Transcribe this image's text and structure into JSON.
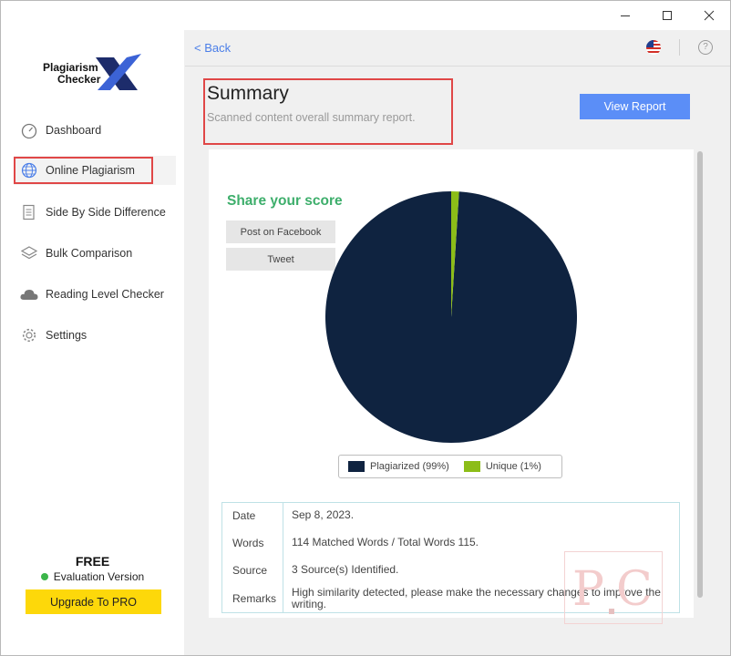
{
  "window": {
    "controls": [
      "minimize",
      "maximize",
      "close"
    ]
  },
  "sidebar": {
    "logo": {
      "line1": "Plagiarism",
      "line2": "Checker",
      "mark": "X"
    },
    "items": [
      {
        "label": "Dashboard",
        "icon": "gauge-icon"
      },
      {
        "label": "Online Plagiarism",
        "icon": "globe-icon",
        "active": true
      },
      {
        "label": "Side By Side Difference",
        "icon": "document-icon"
      },
      {
        "label": "Bulk Comparison",
        "icon": "layers-icon"
      },
      {
        "label": "Reading Level Checker",
        "icon": "cloud-icon"
      },
      {
        "label": "Settings",
        "icon": "gear-icon"
      }
    ],
    "plan": {
      "name": "FREE",
      "version": "Evaluation Version",
      "status_color": "#3bb54a"
    },
    "upgrade_label": "Upgrade To PRO"
  },
  "header": {
    "back_label": "< Back",
    "language_icon": "us-flag-icon",
    "help_icon": "help-icon"
  },
  "summary": {
    "title": "Summary",
    "subtitle": "Scanned content overall summary report.",
    "view_report_label": "View Report"
  },
  "share": {
    "title": "Share your score",
    "facebook_label": "Post on Facebook",
    "tweet_label": "Tweet"
  },
  "chart_data": {
    "type": "pie",
    "series": [
      {
        "name": "Plagiarized (99%)",
        "value": 99,
        "color": "#0f2340"
      },
      {
        "name": "Unique (1%)",
        "value": 1,
        "color": "#8cbd18"
      }
    ],
    "legend_position": "bottom"
  },
  "details": {
    "rows": [
      {
        "label": "Date",
        "value": "Sep 8, 2023."
      },
      {
        "label": "Words",
        "value": "114 Matched Words / Total Words 115."
      },
      {
        "label": "Source",
        "value": "3 Source(s) Identified."
      },
      {
        "label": "Remarks",
        "value": "High similarity detected, please make the necessary changes to improve the writing."
      }
    ]
  },
  "colors": {
    "accent": "#5b8ef7",
    "upgrade": "#fdd80a",
    "share_title": "#3dae6b",
    "highlight_box": "#e04747"
  }
}
